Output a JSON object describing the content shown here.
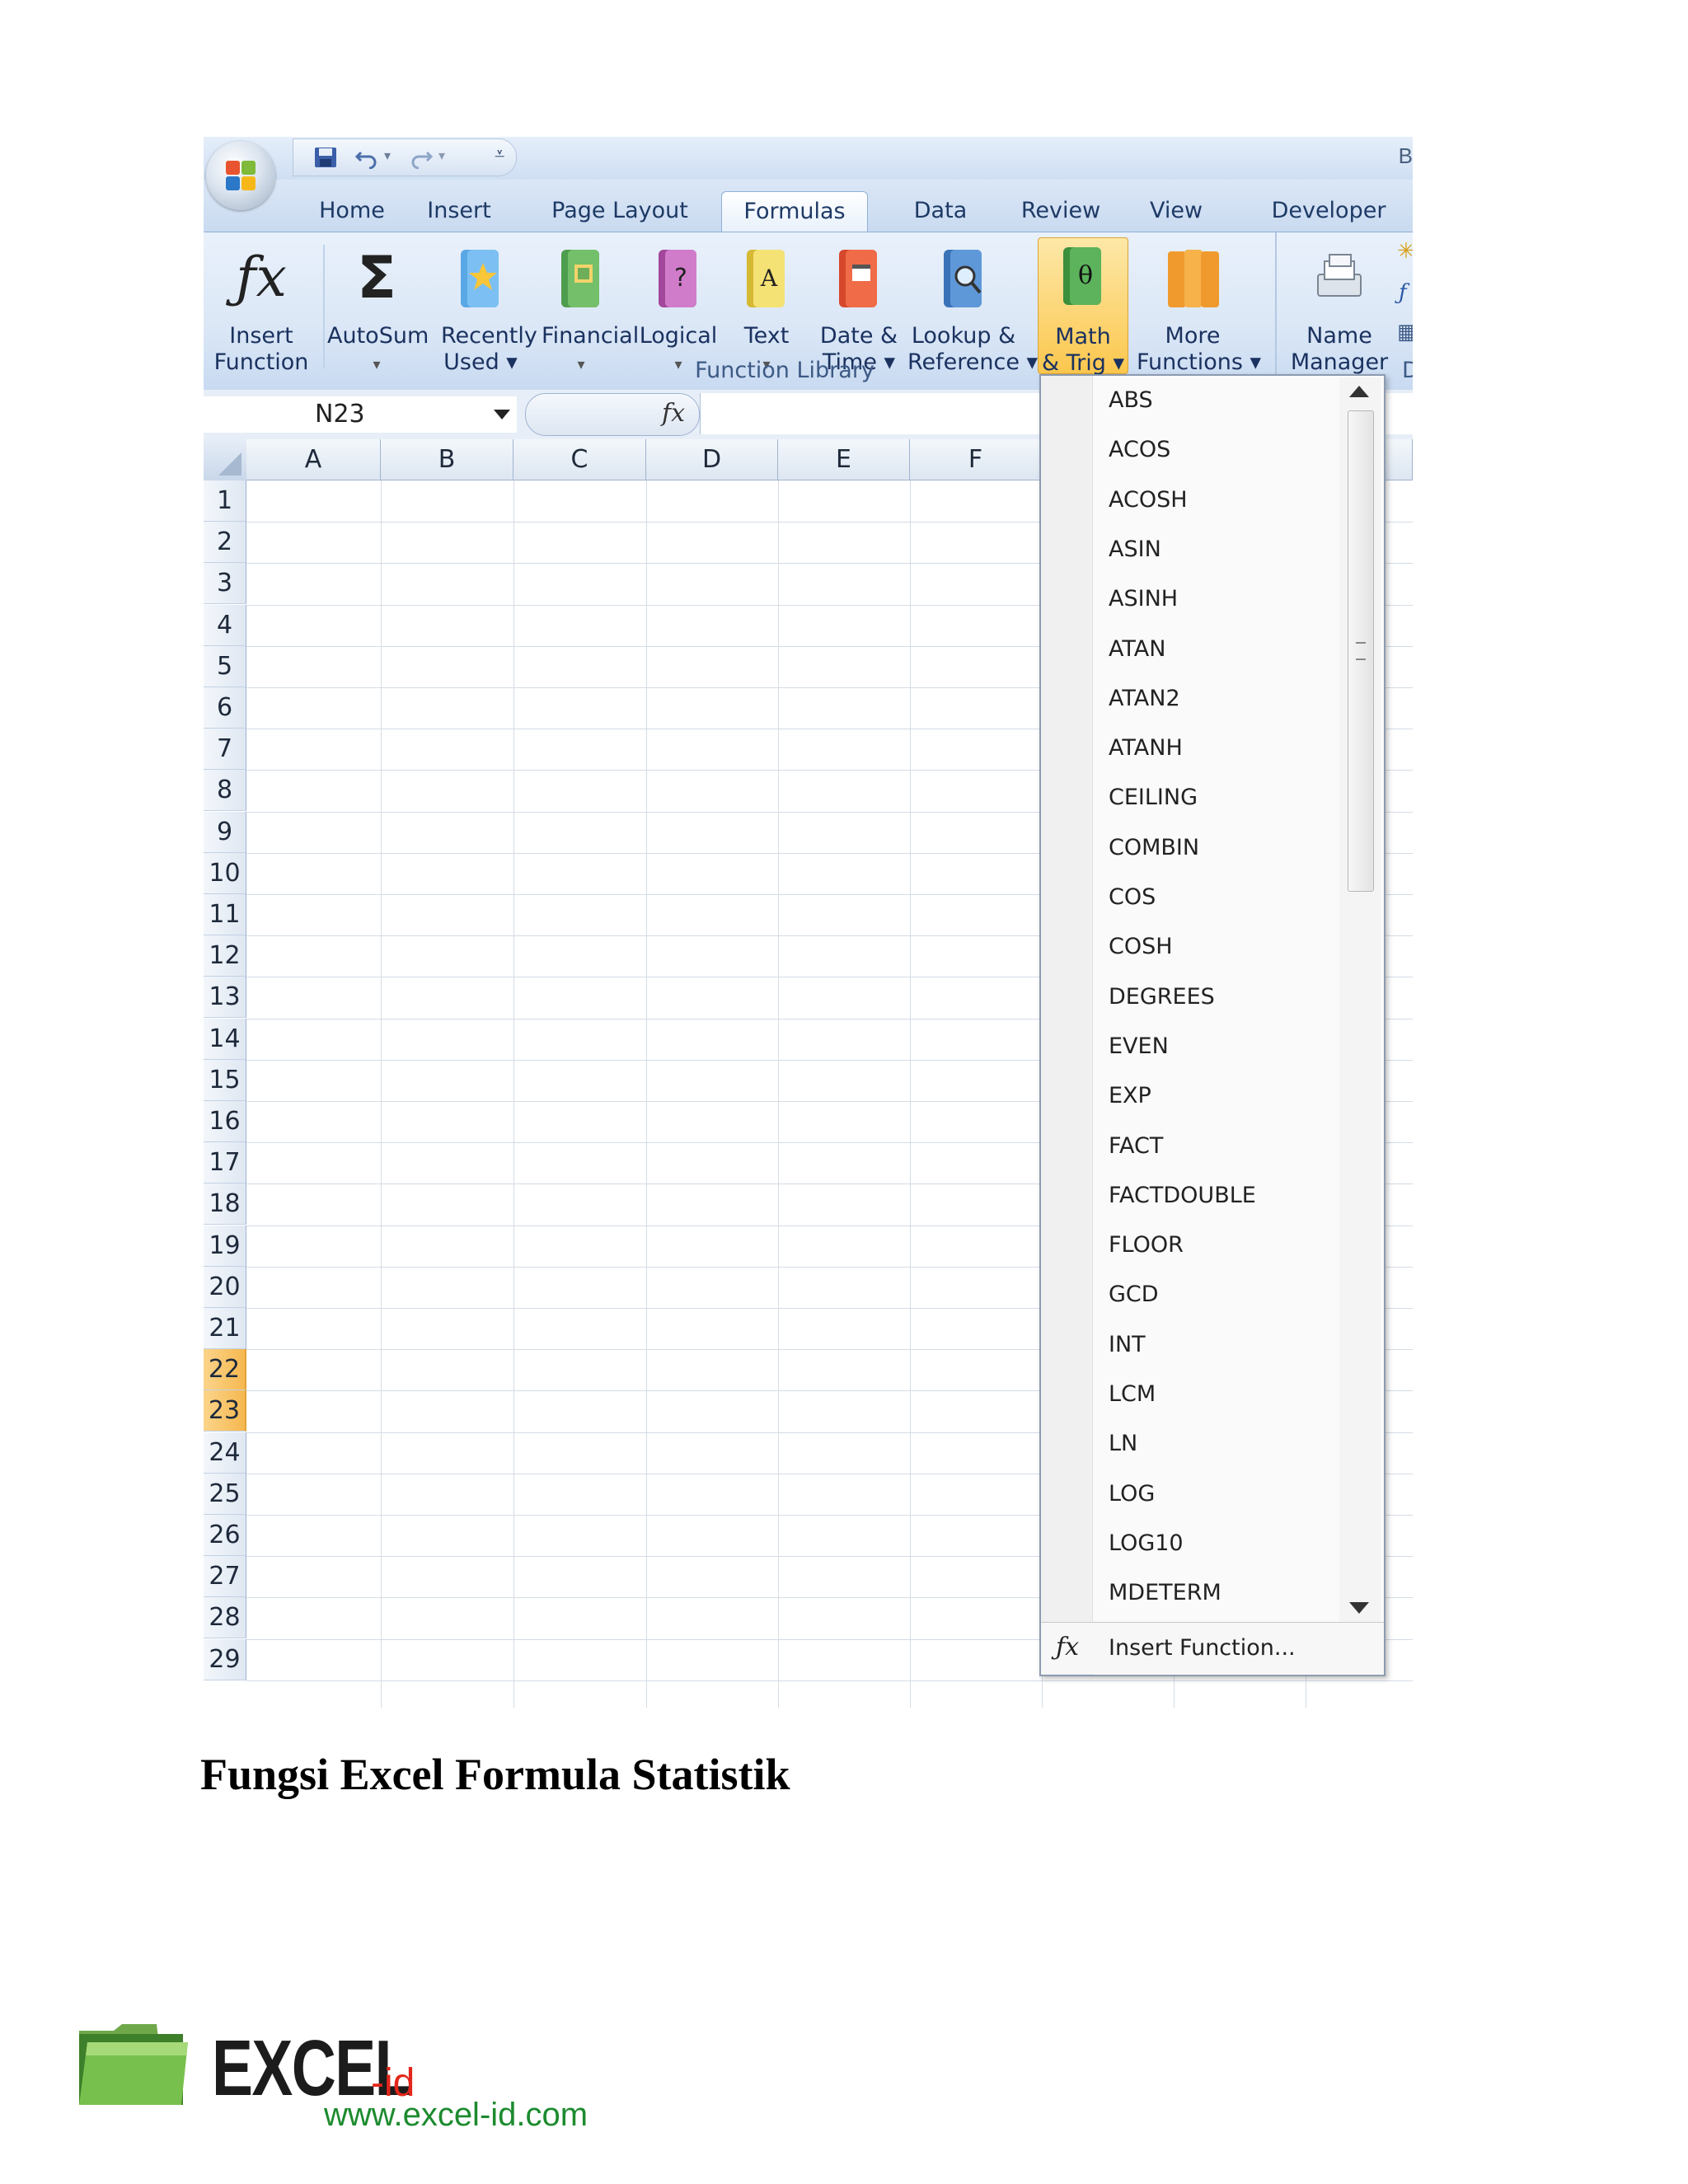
{
  "window": {
    "title_fragment": "B"
  },
  "tabs": [
    "Home",
    "Insert",
    "Page Layout",
    "Formulas",
    "Data",
    "Review",
    "View",
    "Developer"
  ],
  "active_tab": "Formulas",
  "ribbon": {
    "group_label": "Function Library",
    "buttons": [
      {
        "line1": "Insert",
        "line2": "Function",
        "icon": "fx-icon"
      },
      {
        "line1": "AutoSum",
        "line2": "▾",
        "icon": "sigma-icon"
      },
      {
        "line1": "Recently",
        "line2": "Used ▾",
        "icon": "book-star-icon"
      },
      {
        "line1": "Financial",
        "line2": "▾",
        "icon": "book-financial-icon"
      },
      {
        "line1": "Logical",
        "line2": "▾",
        "icon": "book-question-icon"
      },
      {
        "line1": "Text",
        "line2": "▾",
        "icon": "book-text-icon"
      },
      {
        "line1": "Date &",
        "line2": "Time ▾",
        "icon": "book-calendar-icon"
      },
      {
        "line1": "Lookup &",
        "line2": "Reference ▾",
        "icon": "book-magnifier-icon"
      },
      {
        "line1": "Math",
        "line2": "& Trig ▾",
        "icon": "book-theta-icon"
      },
      {
        "line1": "More",
        "line2": "Functions ▾",
        "icon": "books-more-icon"
      },
      {
        "line1": "Name",
        "line2": "Manager",
        "icon": "name-manager-icon"
      }
    ],
    "next_group_initial": "D"
  },
  "formula_bar": {
    "name_box": "N23",
    "fx_label": "fx",
    "formula": ""
  },
  "columns": [
    "A",
    "B",
    "C",
    "D",
    "E",
    "F"
  ],
  "rows": [
    "1",
    "2",
    "3",
    "4",
    "5",
    "6",
    "7",
    "8",
    "9",
    "10",
    "11",
    "12",
    "13",
    "14",
    "15",
    "16",
    "17",
    "18",
    "19",
    "20",
    "21",
    "22",
    "23",
    "24",
    "25",
    "26",
    "27",
    "28",
    "29"
  ],
  "selected_rows": [
    "22",
    "23"
  ],
  "dropdown": {
    "items": [
      "ABS",
      "ACOS",
      "ACOSH",
      "ASIN",
      "ASINH",
      "ATAN",
      "ATAN2",
      "ATANH",
      "CEILING",
      "COMBIN",
      "COS",
      "COSH",
      "DEGREES",
      "EVEN",
      "EXP",
      "FACT",
      "FACTDOUBLE",
      "FLOOR",
      "GCD",
      "INT",
      "LCM",
      "LN",
      "LOG",
      "LOG10",
      "MDETERM"
    ],
    "footer_label": "Insert Function..."
  },
  "caption": "Fungsi Excel Formula Statistik",
  "logo": {
    "brand": "EXCEL",
    "suffix": "-id",
    "url": "www.excel-id.com"
  },
  "colors": {
    "ribbon_blue": "#dbe7f6",
    "highlight_orange": "#fbc74e",
    "selected_row": "#f6b850",
    "logo_red": "#e3261b",
    "logo_green": "#1d8b2f"
  }
}
